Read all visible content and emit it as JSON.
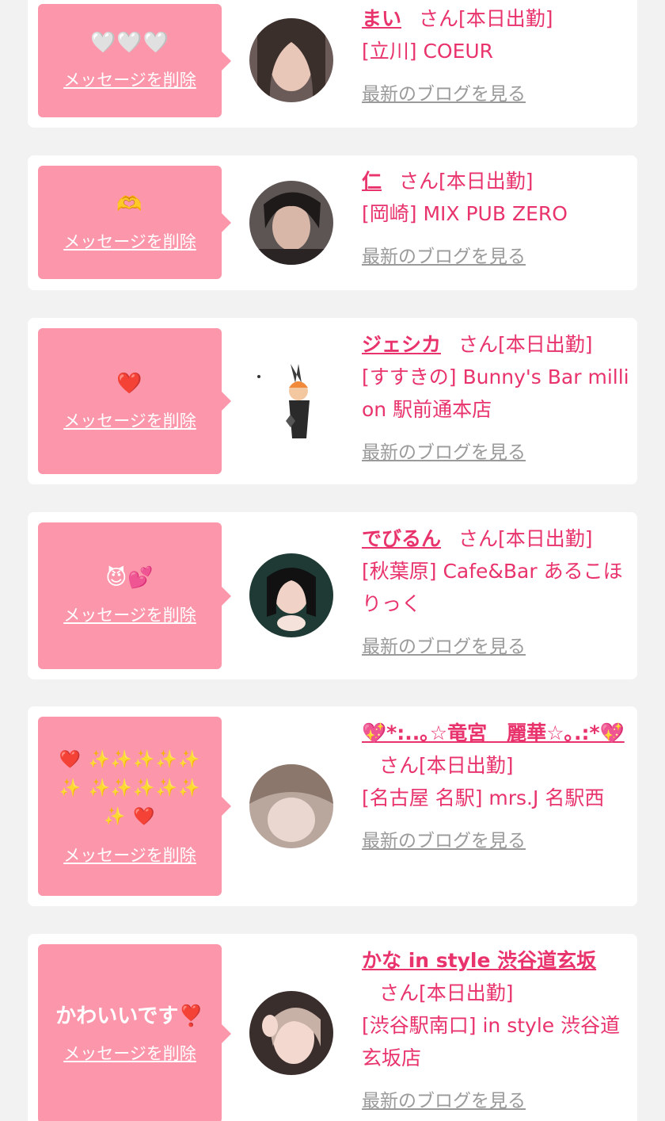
{
  "colors": {
    "bubble": "#fc97ab",
    "accent": "#e8336c",
    "link_gray": "#9a9a9a",
    "background": "#f2f2f2"
  },
  "delete_label": "メッセージを削除",
  "blog_label": "最新のブログを見る",
  "suffix_label": "さん[本日出勤]",
  "cards": [
    {
      "message": "🤍🤍🤍",
      "name": "まい",
      "shop": "[立川] COEUR",
      "avatar_icon": "profile-photo"
    },
    {
      "message": "🫶",
      "name": "仁",
      "shop": "[岡崎] MIX PUB ZERO",
      "avatar_icon": "profile-photo"
    },
    {
      "message": "❤️",
      "name": "ジェシカ",
      "shop": "[すすきの] Bunny's Bar million 駅前通本店",
      "avatar_icon": "profile-photo"
    },
    {
      "message": "😈💕",
      "name": "でびるん",
      "shop": "[秋葉原] Cafe&Bar あるこほりっく",
      "avatar_icon": "profile-photo"
    },
    {
      "message": "❤️ ✨✨✨✨✨✨ ✨✨✨✨✨✨ ❤️",
      "name": "💖*:..｡☆竜宮　麗華☆｡.:*💖",
      "shop": "[名古屋 名駅] mrs.J 名駅西",
      "avatar_icon": "profile-photo"
    },
    {
      "message": "かわいいです❣️",
      "name": "かな in style 渋谷道玄坂",
      "shop": "[渋谷駅南口] in style 渋谷道玄坂店",
      "avatar_icon": "profile-photo"
    }
  ]
}
